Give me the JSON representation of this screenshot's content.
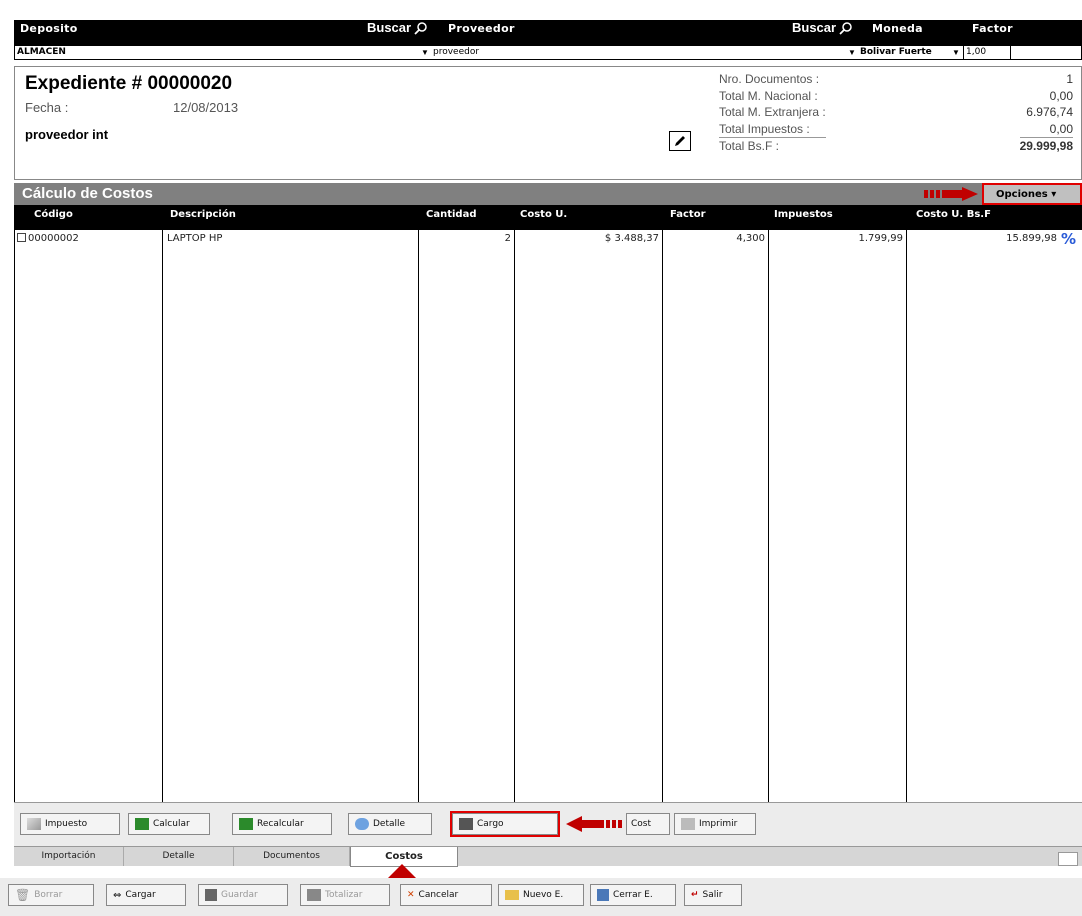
{
  "header": {
    "deposito_label": "Deposito",
    "buscar1": "Buscar",
    "proveedor_label": "Proveedor",
    "buscar2": "Buscar",
    "moneda_label": "Moneda",
    "factor_label": "Factor",
    "deposito_value": "ALMACEN",
    "proveedor_value": "proveedor",
    "moneda_value": "Bolivar Fuerte",
    "factor_value": "1,00"
  },
  "expediente": {
    "title": "Expediente # 00000020",
    "fecha_label": "Fecha :",
    "fecha_value": "12/08/2013",
    "proveedor": "proveedor int",
    "totals_labels": [
      "Nro. Documentos :",
      "Total M. Nacional :",
      "Total M. Extranjera :",
      "Total Impuestos :",
      "Total Bs.F :"
    ],
    "totals_values": [
      "1",
      "0,00",
      "6.976,74",
      "0,00",
      "29.999,98"
    ]
  },
  "calculo": {
    "title": "Cálculo de Costos",
    "opciones": "Opciones"
  },
  "table": {
    "headers": [
      "Código",
      "Descripción",
      "Cantidad",
      "Costo U.",
      "Factor",
      "Impuestos",
      "Costo U. Bs.F"
    ],
    "rows": [
      [
        "00000002",
        "LAPTOP HP",
        "2",
        "$ 3.488,37",
        "4,300",
        "1.799,99",
        "15.899,98"
      ]
    ]
  },
  "toolbar": {
    "impuesto": "Impuesto",
    "calcular": "Calcular",
    "recalcular": "Recalcular",
    "detalle": "Detalle",
    "cargo": "Cargo",
    "cost": "Cost",
    "imprimir": "Imprimir"
  },
  "tabs": [
    "Importación",
    "Detalle",
    "Documentos",
    "Costos"
  ],
  "bottom": {
    "borrar": "Borrar",
    "cargar": "Cargar",
    "guardar": "Guardar",
    "totalizar": "Totalizar",
    "cancelar": "Cancelar",
    "nuevo": "Nuevo E.",
    "cerrar": "Cerrar E.",
    "salir": "Salir"
  },
  "colors": {
    "highlight": "#e00000",
    "accent_arrow": "#c00000",
    "header_bg": "#000000",
    "bar_bg": "#808080"
  }
}
